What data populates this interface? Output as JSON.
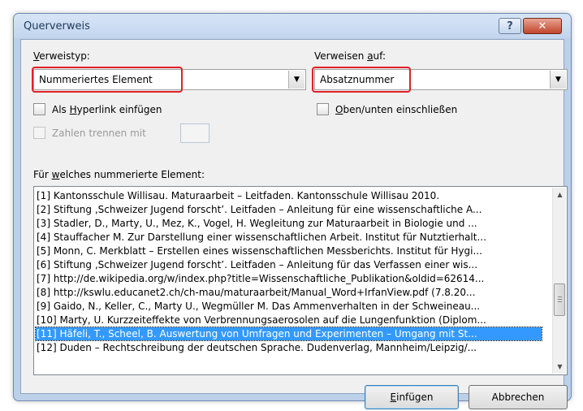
{
  "window": {
    "title": "Querverweis",
    "help_glyph": "?",
    "close_glyph": "✕"
  },
  "reference_type": {
    "label_mnemonic": "V",
    "label_rest": "erweistyp:",
    "value": "Nummeriertes Element"
  },
  "reference_to": {
    "label_prefix": "Verweisen ",
    "label_mnemonic": "a",
    "label_rest": "uf:",
    "value": "Absatznummer"
  },
  "hyperlink": {
    "label_prefix": "Als ",
    "label_mnemonic": "H",
    "label_rest": "yperlink einfügen"
  },
  "above_below": {
    "label_mnemonic": "O",
    "label_rest": "ben/unten einschließen"
  },
  "separate_numbers": {
    "label": "Zahlen trennen mit"
  },
  "list": {
    "label_prefix": "Für ",
    "label_mnemonic": "w",
    "label_rest": "elches nummerierte Element:",
    "items": [
      "[1] Kantonsschule Willisau. Maturaarbeit – Leitfaden. Kantonsschule Willisau 2010.",
      "[2] Stiftung ‚Schweizer Jugend forscht’. Leitfaden – Anleitung für eine wissenschaftliche A...",
      "[3] Stadler, D., Marty, U., Mez, K., Vogel, H. Wegleitung zur Maturaarbeit in Biologie und ...",
      "[4] Stauffacher M. Zur Darstellung einer wissenschaftlichen Arbeit. Institut für Nutztierhalt...",
      "[5] Monn, C. Merkblatt – Erstellen eines wissenschaftlichen Messberichts. Institut für Hygi...",
      "[6] Stiftung ‚Schweizer Jugend forscht’. Leitfaden – Anleitung für das Verfassen einer wis...",
      "[7] http://de.wikipedia.org/w/index.php?title=Wissenschaftliche_Publikation&oldid=62614...",
      "[8] http://kswlu.educanet2.ch/ch-mau/maturaarbeit/Manual_Word+IrfanView.pdf (7.8.20...",
      "[9] Gaido, N., Keller, C., Marty U., Wegmüller M. Das Ammenverhalten in der Schweineau...",
      "[10] Marty, U. Kurzzeiteffekte von Verbrennungsaerosolen auf die Lungenfunktion (Diplom...",
      "[11] Häfeli, T., Scheel, B. Auswertung von Umfragen und Experimenten – Umgang mit St...",
      "[12] Duden – Rechtschreibung der deutschen Sprache. Dudenverlag, Mannheim/Leipzig/..."
    ],
    "selected_index": 10
  },
  "buttons": {
    "insert_mnemonic": "E",
    "insert_rest": "infügen",
    "cancel": "Abbrechen"
  },
  "colors": {
    "highlight": "#e0202a",
    "selection": "#3399ff"
  }
}
